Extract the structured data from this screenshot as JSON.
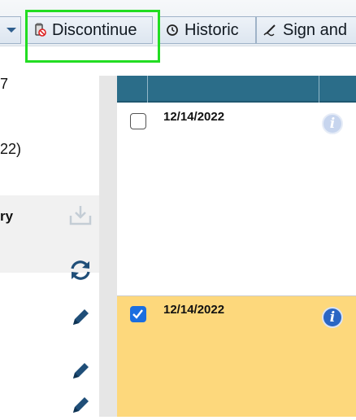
{
  "toolbar": {
    "discontinue_label": "Discontinue",
    "historic_label": "Historic",
    "sign_label": "Sign and",
    "icons": {
      "discontinue": "discontinue-icon",
      "historic": "clock-icon",
      "sign": "pen-sign-icon"
    }
  },
  "left_pane": {
    "line1": "7",
    "line2": "22)",
    "section_label": "ry",
    "icons": [
      "download-icon",
      "refresh-icon",
      "pencil-icon",
      "pencil-icon",
      "pencil-icon"
    ]
  },
  "grid": {
    "rows": [
      {
        "date": "12/14/2022",
        "checked": false
      },
      {
        "date": "12/14/2022",
        "checked": true
      }
    ],
    "header_color": "#2b6d89",
    "selected_row_color": "#fdd87c"
  }
}
